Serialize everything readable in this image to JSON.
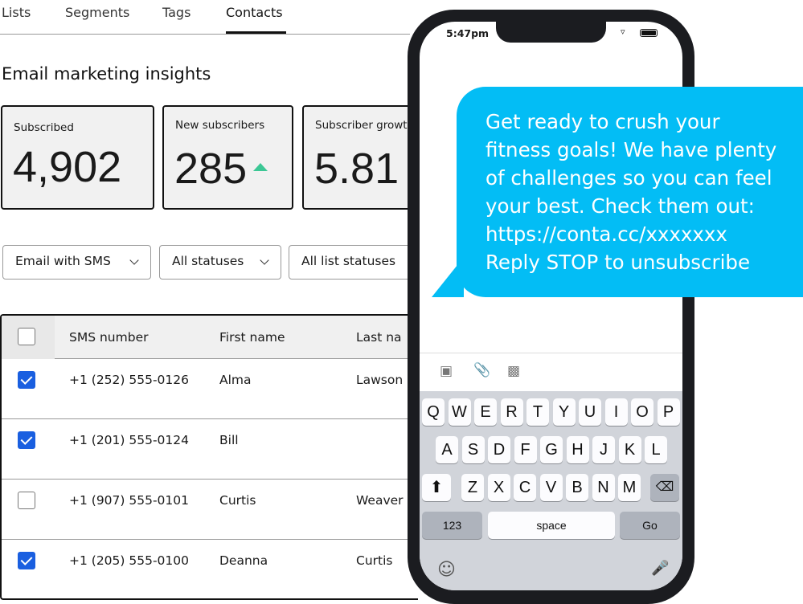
{
  "tabs": [
    "Lists",
    "Segments",
    "Tags",
    "Contacts"
  ],
  "active_tab": "Contacts",
  "heading": "Email marketing insights",
  "cards": [
    {
      "label": "Subscribed",
      "value": "4,902"
    },
    {
      "label": "New subscribers",
      "value": "285",
      "trend": "up"
    },
    {
      "label": "Subscriber growt",
      "value": "5.81"
    }
  ],
  "filters": [
    "Email with SMS",
    "All statuses",
    "All list statuses"
  ],
  "table": {
    "headers": [
      "SMS number",
      "First name",
      "Last na"
    ],
    "rows": [
      {
        "checked": true,
        "sms": "+1 (252) 555-0126",
        "first": "Alma",
        "last": "Lawson"
      },
      {
        "checked": true,
        "sms": "+1 (201) 555-0124",
        "first": "Bill",
        "last": ""
      },
      {
        "checked": false,
        "sms": "+1 (907) 555-0101",
        "first": "Curtis",
        "last": "Weaver"
      },
      {
        "checked": true,
        "sms": "+1 (205) 555-0100",
        "first": "Deanna",
        "last": "Curtis"
      }
    ]
  },
  "phone": {
    "time": "5:47pm",
    "message_lines": [
      "Get ready to crush your",
      "fitness goals! We have plenty",
      "of challenges so you can feel",
      "your best. Check them out:",
      "https://conta.cc/xxxxxxx",
      "Reply STOP to unsubscribe"
    ],
    "bubble_color": "#03bdf5",
    "keyboard": {
      "row1": [
        "Q",
        "W",
        "E",
        "R",
        "T",
        "Y",
        "U",
        "I",
        "O",
        "P"
      ],
      "row2": [
        "A",
        "S",
        "D",
        "F",
        "G",
        "H",
        "J",
        "K",
        "L"
      ],
      "row3": [
        "Z",
        "X",
        "C",
        "V",
        "B",
        "N",
        "M"
      ],
      "numbers": "123",
      "space": "space",
      "go": "Go"
    }
  }
}
